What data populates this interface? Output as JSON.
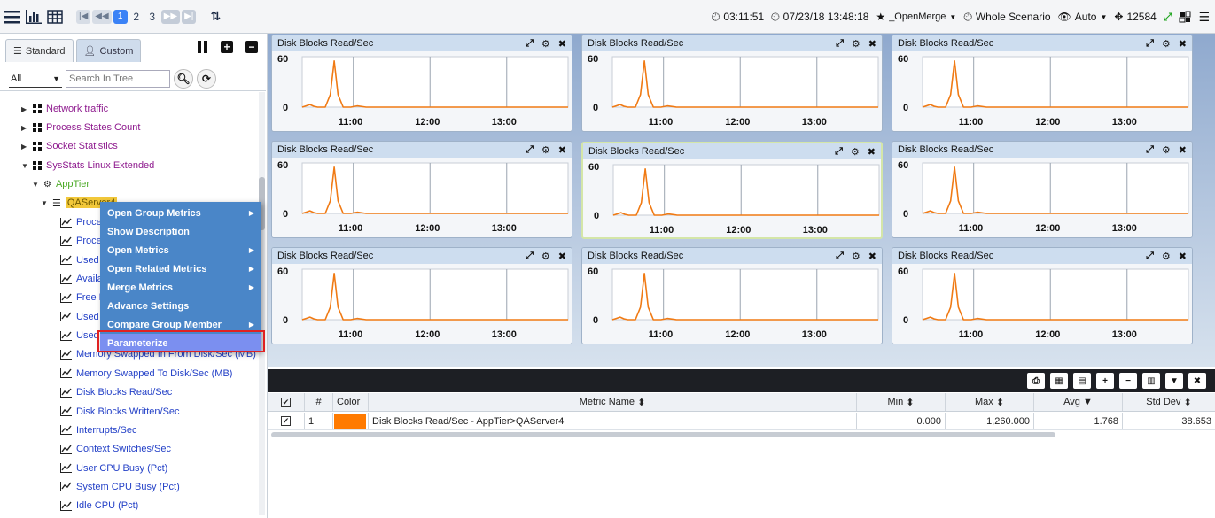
{
  "toolbar": {
    "pages": [
      "1",
      "2",
      "3"
    ],
    "time": "03:11:51",
    "datetime": "07/23/18 13:48:18",
    "merge_label": "_OpenMerge",
    "scenario": "Whole Scenario",
    "mode": "Auto",
    "count": "12584"
  },
  "left_panel": {
    "tabs": {
      "standard": "Standard",
      "custom": "Custom"
    },
    "filter_value": "All",
    "search_placeholder": "Search In Tree",
    "tree": [
      {
        "label": "Network traffic",
        "level": 1
      },
      {
        "label": "Process States Count",
        "level": 1
      },
      {
        "label": "Socket Statistics",
        "level": 1
      },
      {
        "label": "SysStats Linux Extended",
        "level": 1
      },
      {
        "label": "AppTier",
        "level": 2
      },
      {
        "label": "QAServer4",
        "level": 3
      }
    ],
    "metrics": [
      "Proce",
      "Proce",
      "Used",
      "Availa",
      "Free M",
      "Used",
      "Used",
      "Memory Swapped In From Disk/Sec (MB)",
      "Memory Swapped To Disk/Sec (MB)",
      "Disk Blocks Read/Sec",
      "Disk Blocks Written/Sec",
      "Interrupts/Sec",
      "Context Switches/Sec",
      "User CPU Busy (Pct)",
      "System CPU Busy (Pct)",
      "Idle CPU (Pct)"
    ],
    "context_menu": [
      {
        "label": "Open Group Metrics",
        "submenu": true
      },
      {
        "label": "Show Description",
        "submenu": false
      },
      {
        "label": "Open Metrics",
        "submenu": true
      },
      {
        "label": "Open Related Metrics",
        "submenu": true
      },
      {
        "label": "Merge Metrics",
        "submenu": true
      },
      {
        "label": "Advance Settings",
        "submenu": false
      },
      {
        "label": "Compare Group Member",
        "submenu": true
      },
      {
        "label": "Parameterize",
        "submenu": false
      }
    ]
  },
  "dashboard": {
    "panel_title": "Disk Blocks Read/Sec",
    "colors": {
      "line": "#f07a14",
      "accent": "#3b82f6"
    },
    "chart_data": {
      "type": "line",
      "title": "Disk Blocks Read/Sec",
      "xlabel": "",
      "ylabel": "",
      "y_ticks": [
        "60",
        "0"
      ],
      "x_ticks": [
        "11:00",
        "12:00",
        "13:00"
      ],
      "ylim": [
        0,
        60
      ],
      "x": [
        "10:20",
        "10:23",
        "10:26",
        "10:29",
        "10:32",
        "10:38",
        "10:42",
        "10:45",
        "10:48",
        "10:52",
        "10:58",
        "11:03",
        "11:10",
        "11:20",
        "12:00",
        "13:00",
        "13:48"
      ],
      "series": [
        {
          "values": [
            0,
            1.5,
            3,
            1,
            0,
            0,
            15,
            55,
            15,
            0,
            0,
            1.5,
            0,
            0,
            0,
            0,
            0
          ]
        }
      ]
    }
  },
  "grid": {
    "headers": {
      "num": "#",
      "color": "Color",
      "metric": "Metric Name",
      "min": "Min",
      "max": "Max",
      "avg": "Avg",
      "std": "Std Dev"
    },
    "rows": [
      {
        "num": "1",
        "color": "#ff7a00",
        "metric": "Disk Blocks Read/Sec - AppTier>QAServer4",
        "min": "0.000",
        "max": "1,260.000",
        "avg": "1.768",
        "std": "38.653"
      }
    ]
  }
}
